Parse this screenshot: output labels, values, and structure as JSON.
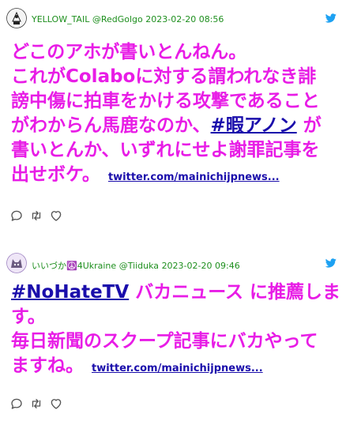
{
  "tweets": [
    {
      "author_name": "YELLOW_TAIL",
      "handle": "@RedGolgo",
      "timestamp": "2023-02-20 08:56",
      "avatar_icon": "emblem-avatar-icon",
      "lines": [
        "どこのアホが書いとんねん。",
        "これがColaboに対する謂われなき誹",
        "謗中傷に拍車をかける攻撃であること",
        "がわからん馬鹿なのか、",
        "書いとんか、いずれにせよ謝罪記事を",
        "出せボケ。"
      ],
      "hashtag": "#暇アノン",
      "after_hashtag": " が",
      "link": "twitter.com/mainichijpnews..."
    },
    {
      "author_name": "いいづか☮️4Ukraine",
      "handle": "@Tiiduka",
      "timestamp": "2023-02-20 09:46",
      "avatar_icon": "cat-avatar-icon",
      "hashtag": "#NoHateTV",
      "after_hashtag": " バカニュース に推薦しま",
      "lines": [
        "す。",
        "毎日新聞のスクープ記事にバカやって",
        "ますね。"
      ],
      "link": "twitter.com/mainichijpnews..."
    }
  ],
  "colors": {
    "text_magenta": "#e81ce6",
    "link_blue": "#1a0dab",
    "meta_green": "#1e8f1e",
    "twitter_blue": "#1da1f2",
    "icon_gray": "#555555"
  }
}
